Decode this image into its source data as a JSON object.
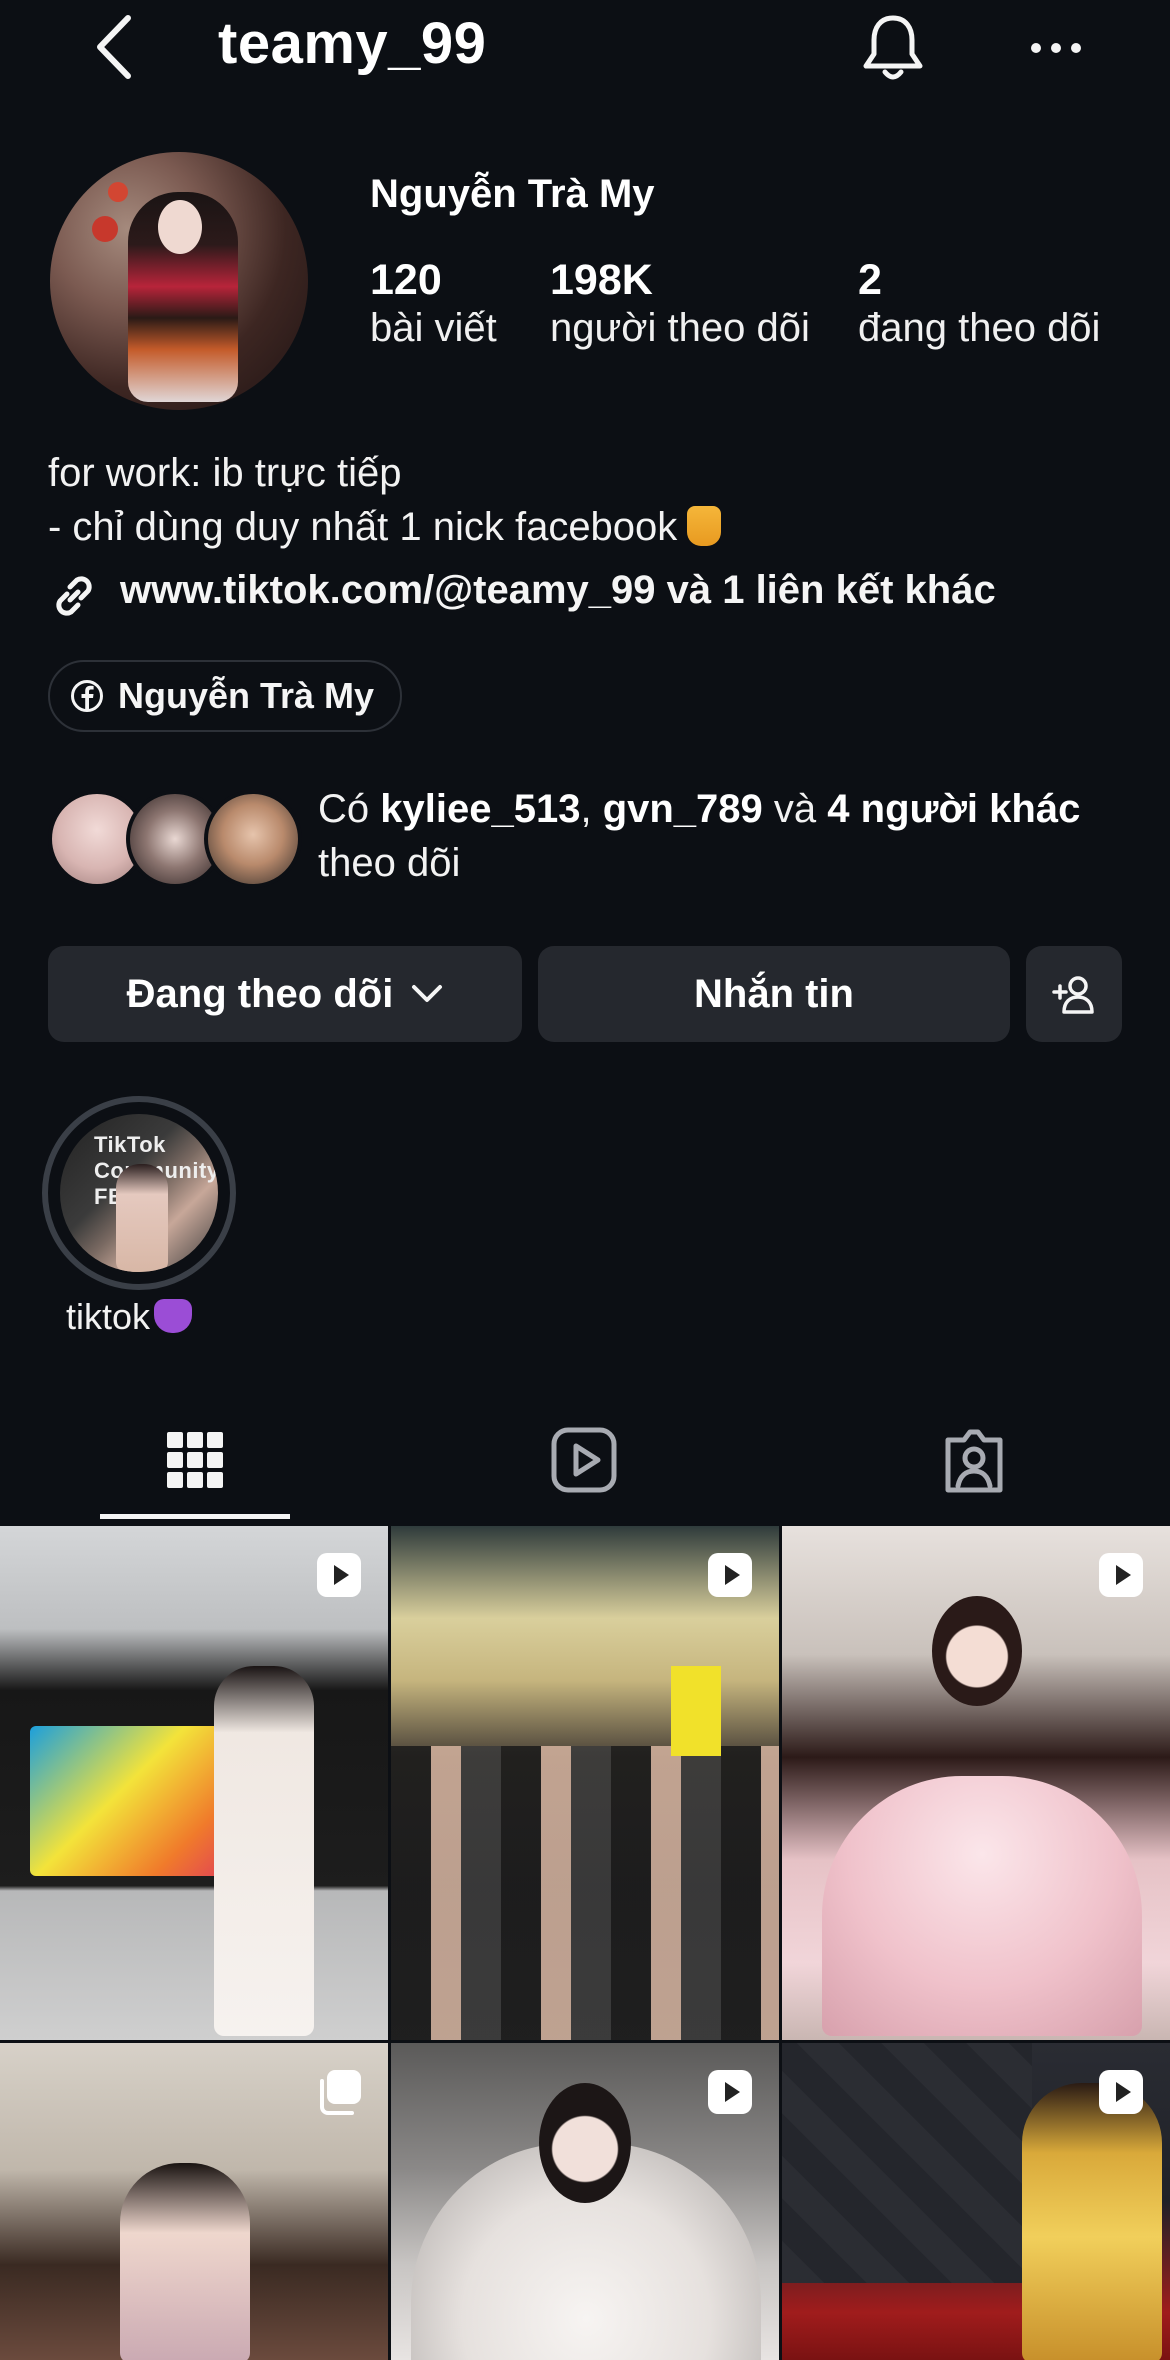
{
  "header": {
    "username": "teamy_99",
    "back_icon": "chevron-left-icon",
    "bell_icon": "bell-icon",
    "more_icon": "more-horizontal-icon"
  },
  "profile": {
    "display_name": "Nguyễn Trà My",
    "stats": [
      {
        "value": "120",
        "label": "bài viết"
      },
      {
        "value": "198K",
        "label": "người theo dõi"
      },
      {
        "value": "2",
        "label": "đang theo dõi"
      }
    ],
    "bio_line1": "for work: ib trực tiếp",
    "bio_line2": "- chỉ dùng duy nhất 1 nick facebook",
    "bio_emoji": "pointing-down-hand-emoji",
    "link_text": "www.tiktok.com/@teamy_99 và 1 liên kết khác",
    "facebook_chip": "Nguyễn Trà My"
  },
  "followed_by": {
    "prefix": "Có ",
    "user1": "kyliee_513",
    "separator": ", ",
    "user2": "gvn_789",
    "and": " và ",
    "others": "4 người khác",
    "suffix": " theo dõi"
  },
  "actions": {
    "following_label": "Đang theo dõi",
    "message_label": "Nhắn tin",
    "add_user_icon": "add-user-icon"
  },
  "highlights": [
    {
      "label": "tiktok",
      "cover_text": "TikTok Community FEST"
    }
  ],
  "tabs": [
    {
      "name": "posts-grid",
      "icon": "grid-icon",
      "active": true
    },
    {
      "name": "reels",
      "icon": "reels-icon",
      "active": false
    },
    {
      "name": "tagged",
      "icon": "tagged-user-icon",
      "active": false
    }
  ],
  "grid_posts": [
    {
      "type": "reel",
      "badge_icon": "reel-play-icon"
    },
    {
      "type": "reel",
      "badge_icon": "reel-play-icon"
    },
    {
      "type": "reel",
      "badge_icon": "reel-play-icon"
    },
    {
      "type": "carousel",
      "badge_icon": "carousel-icon"
    },
    {
      "type": "reel",
      "badge_icon": "reel-play-icon"
    },
    {
      "type": "reel",
      "badge_icon": "reel-play-icon"
    }
  ],
  "colors": {
    "background": "#0c0f14",
    "button": "#25282e",
    "text": "#f5f5f5"
  }
}
